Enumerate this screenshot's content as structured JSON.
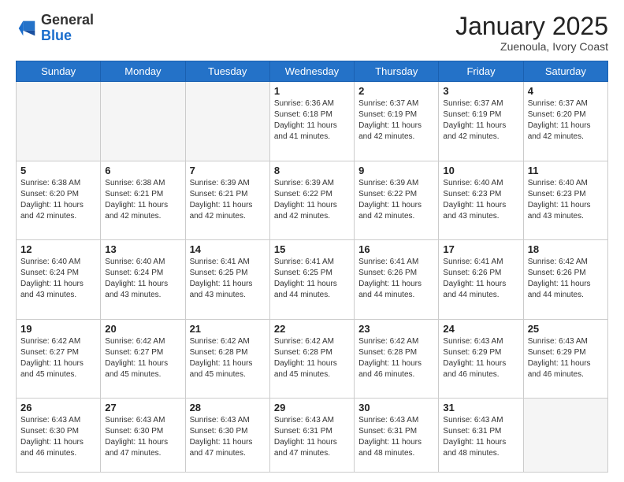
{
  "header": {
    "logo_general": "General",
    "logo_blue": "Blue",
    "month_year": "January 2025",
    "location": "Zuenoula, Ivory Coast"
  },
  "weekdays": [
    "Sunday",
    "Monday",
    "Tuesday",
    "Wednesday",
    "Thursday",
    "Friday",
    "Saturday"
  ],
  "weeks": [
    [
      {
        "day": "",
        "sunrise": "",
        "sunset": "",
        "daylight": "",
        "empty": true
      },
      {
        "day": "",
        "sunrise": "",
        "sunset": "",
        "daylight": "",
        "empty": true
      },
      {
        "day": "",
        "sunrise": "",
        "sunset": "",
        "daylight": "",
        "empty": true
      },
      {
        "day": "1",
        "sunrise": "Sunrise: 6:36 AM",
        "sunset": "Sunset: 6:18 PM",
        "daylight": "Daylight: 11 hours and 41 minutes."
      },
      {
        "day": "2",
        "sunrise": "Sunrise: 6:37 AM",
        "sunset": "Sunset: 6:19 PM",
        "daylight": "Daylight: 11 hours and 42 minutes."
      },
      {
        "day": "3",
        "sunrise": "Sunrise: 6:37 AM",
        "sunset": "Sunset: 6:19 PM",
        "daylight": "Daylight: 11 hours and 42 minutes."
      },
      {
        "day": "4",
        "sunrise": "Sunrise: 6:37 AM",
        "sunset": "Sunset: 6:20 PM",
        "daylight": "Daylight: 11 hours and 42 minutes."
      }
    ],
    [
      {
        "day": "5",
        "sunrise": "Sunrise: 6:38 AM",
        "sunset": "Sunset: 6:20 PM",
        "daylight": "Daylight: 11 hours and 42 minutes."
      },
      {
        "day": "6",
        "sunrise": "Sunrise: 6:38 AM",
        "sunset": "Sunset: 6:21 PM",
        "daylight": "Daylight: 11 hours and 42 minutes."
      },
      {
        "day": "7",
        "sunrise": "Sunrise: 6:39 AM",
        "sunset": "Sunset: 6:21 PM",
        "daylight": "Daylight: 11 hours and 42 minutes."
      },
      {
        "day": "8",
        "sunrise": "Sunrise: 6:39 AM",
        "sunset": "Sunset: 6:22 PM",
        "daylight": "Daylight: 11 hours and 42 minutes."
      },
      {
        "day": "9",
        "sunrise": "Sunrise: 6:39 AM",
        "sunset": "Sunset: 6:22 PM",
        "daylight": "Daylight: 11 hours and 42 minutes."
      },
      {
        "day": "10",
        "sunrise": "Sunrise: 6:40 AM",
        "sunset": "Sunset: 6:23 PM",
        "daylight": "Daylight: 11 hours and 43 minutes."
      },
      {
        "day": "11",
        "sunrise": "Sunrise: 6:40 AM",
        "sunset": "Sunset: 6:23 PM",
        "daylight": "Daylight: 11 hours and 43 minutes."
      }
    ],
    [
      {
        "day": "12",
        "sunrise": "Sunrise: 6:40 AM",
        "sunset": "Sunset: 6:24 PM",
        "daylight": "Daylight: 11 hours and 43 minutes."
      },
      {
        "day": "13",
        "sunrise": "Sunrise: 6:40 AM",
        "sunset": "Sunset: 6:24 PM",
        "daylight": "Daylight: 11 hours and 43 minutes."
      },
      {
        "day": "14",
        "sunrise": "Sunrise: 6:41 AM",
        "sunset": "Sunset: 6:25 PM",
        "daylight": "Daylight: 11 hours and 43 minutes."
      },
      {
        "day": "15",
        "sunrise": "Sunrise: 6:41 AM",
        "sunset": "Sunset: 6:25 PM",
        "daylight": "Daylight: 11 hours and 44 minutes."
      },
      {
        "day": "16",
        "sunrise": "Sunrise: 6:41 AM",
        "sunset": "Sunset: 6:26 PM",
        "daylight": "Daylight: 11 hours and 44 minutes."
      },
      {
        "day": "17",
        "sunrise": "Sunrise: 6:41 AM",
        "sunset": "Sunset: 6:26 PM",
        "daylight": "Daylight: 11 hours and 44 minutes."
      },
      {
        "day": "18",
        "sunrise": "Sunrise: 6:42 AM",
        "sunset": "Sunset: 6:26 PM",
        "daylight": "Daylight: 11 hours and 44 minutes."
      }
    ],
    [
      {
        "day": "19",
        "sunrise": "Sunrise: 6:42 AM",
        "sunset": "Sunset: 6:27 PM",
        "daylight": "Daylight: 11 hours and 45 minutes."
      },
      {
        "day": "20",
        "sunrise": "Sunrise: 6:42 AM",
        "sunset": "Sunset: 6:27 PM",
        "daylight": "Daylight: 11 hours and 45 minutes."
      },
      {
        "day": "21",
        "sunrise": "Sunrise: 6:42 AM",
        "sunset": "Sunset: 6:28 PM",
        "daylight": "Daylight: 11 hours and 45 minutes."
      },
      {
        "day": "22",
        "sunrise": "Sunrise: 6:42 AM",
        "sunset": "Sunset: 6:28 PM",
        "daylight": "Daylight: 11 hours and 45 minutes."
      },
      {
        "day": "23",
        "sunrise": "Sunrise: 6:42 AM",
        "sunset": "Sunset: 6:28 PM",
        "daylight": "Daylight: 11 hours and 46 minutes."
      },
      {
        "day": "24",
        "sunrise": "Sunrise: 6:43 AM",
        "sunset": "Sunset: 6:29 PM",
        "daylight": "Daylight: 11 hours and 46 minutes."
      },
      {
        "day": "25",
        "sunrise": "Sunrise: 6:43 AM",
        "sunset": "Sunset: 6:29 PM",
        "daylight": "Daylight: 11 hours and 46 minutes."
      }
    ],
    [
      {
        "day": "26",
        "sunrise": "Sunrise: 6:43 AM",
        "sunset": "Sunset: 6:30 PM",
        "daylight": "Daylight: 11 hours and 46 minutes."
      },
      {
        "day": "27",
        "sunrise": "Sunrise: 6:43 AM",
        "sunset": "Sunset: 6:30 PM",
        "daylight": "Daylight: 11 hours and 47 minutes."
      },
      {
        "day": "28",
        "sunrise": "Sunrise: 6:43 AM",
        "sunset": "Sunset: 6:30 PM",
        "daylight": "Daylight: 11 hours and 47 minutes."
      },
      {
        "day": "29",
        "sunrise": "Sunrise: 6:43 AM",
        "sunset": "Sunset: 6:31 PM",
        "daylight": "Daylight: 11 hours and 47 minutes."
      },
      {
        "day": "30",
        "sunrise": "Sunrise: 6:43 AM",
        "sunset": "Sunset: 6:31 PM",
        "daylight": "Daylight: 11 hours and 48 minutes."
      },
      {
        "day": "31",
        "sunrise": "Sunrise: 6:43 AM",
        "sunset": "Sunset: 6:31 PM",
        "daylight": "Daylight: 11 hours and 48 minutes."
      },
      {
        "day": "",
        "sunrise": "",
        "sunset": "",
        "daylight": "",
        "empty": true
      }
    ]
  ]
}
